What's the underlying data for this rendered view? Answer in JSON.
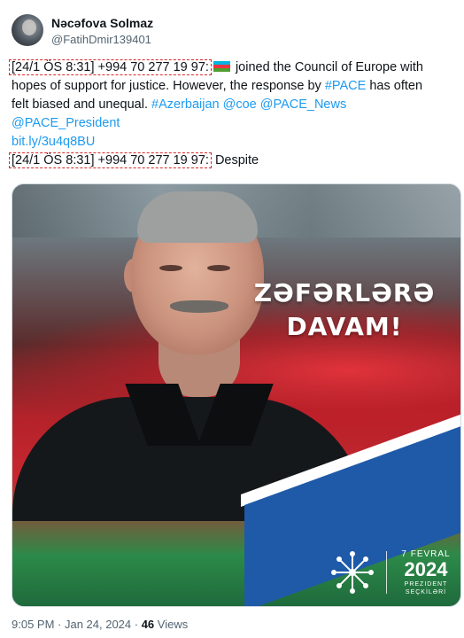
{
  "author": {
    "name": "Nəcəfova Solmaz",
    "handle": "@FatihDmir139401"
  },
  "tweet": {
    "prefix1": "[24/1 ÖS 8:31] +994 70 277 19 97:",
    "line1_rest": " joined the Council of Europe with",
    "line2": "hopes of support for justice. However, the response by ",
    "hashtag_pace": "#PACE",
    "line2_rest": " has often",
    "line3": "felt biased and unequal. ",
    "hashtag_az": "#Azerbaijan",
    "mention_coe": "@coe",
    "mention_pace_news": "@PACE_News",
    "mention_pace_president": "@PACE_President",
    "link": "bit.ly/3u4q8BU",
    "prefix2": "[24/1 ÖS 8:31] +994 70 277 19 97:",
    "line6_rest": " Despite",
    "flag_icon": "azerbaijan-flag-icon"
  },
  "image": {
    "headline_1": "ZƏFƏRLƏRƏ",
    "headline_2": "DAVAM!",
    "date_label": "7 FEVRAL",
    "year": "2024",
    "sub_1": "PREZIDENT",
    "sub_2": "SEÇKİLƏRİ"
  },
  "meta": {
    "time": "9:05 PM · Jan 24, 2024 · ",
    "views_count": "46",
    "views_label": " Views"
  },
  "colors": {
    "link": "#1d9bf0",
    "highlight_border": "#d62828",
    "banner": "#1e5aa8"
  }
}
